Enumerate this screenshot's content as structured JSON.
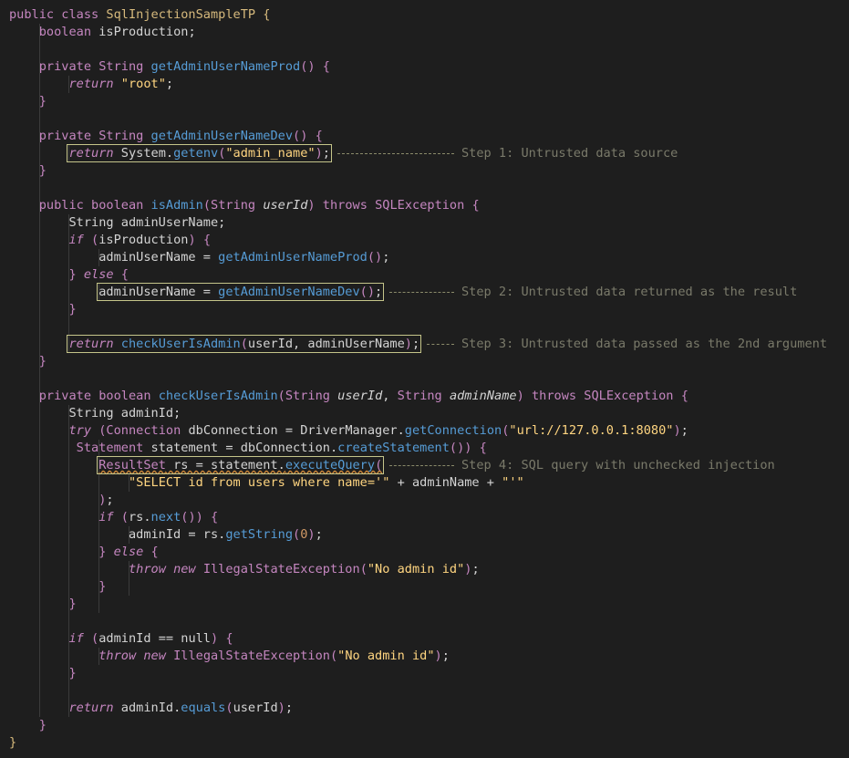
{
  "code": {
    "language": "java",
    "lines": [
      [
        [
          "kw",
          "public"
        ],
        [
          "t",
          " "
        ],
        [
          "kw",
          "class"
        ],
        [
          "t",
          " "
        ],
        [
          "cls",
          "SqlInjectionSampleTP"
        ],
        [
          "t",
          " "
        ],
        [
          "brack2",
          "{"
        ]
      ],
      [
        [
          "t",
          "    "
        ],
        [
          "kw",
          "boolean"
        ],
        [
          "t",
          " isProduction;"
        ]
      ],
      [],
      [
        [
          "t",
          "    "
        ],
        [
          "kw",
          "private"
        ],
        [
          "t",
          " "
        ],
        [
          "kw",
          "String"
        ],
        [
          "t",
          " "
        ],
        [
          "fn",
          "getAdminUserNameProd"
        ],
        [
          "paren",
          "()"
        ],
        [
          "t",
          " "
        ],
        [
          "brack",
          "{"
        ]
      ],
      [
        [
          "t",
          "        "
        ],
        [
          "kwit",
          "return"
        ],
        [
          "t",
          " "
        ],
        [
          "str",
          "\"root\""
        ],
        [
          "t",
          ";"
        ]
      ],
      [
        [
          "t",
          "    "
        ],
        [
          "brack",
          "}"
        ]
      ],
      [],
      [
        [
          "t",
          "    "
        ],
        [
          "kw",
          "private"
        ],
        [
          "t",
          " "
        ],
        [
          "kw",
          "String"
        ],
        [
          "t",
          " "
        ],
        [
          "fn",
          "getAdminUserNameDev"
        ],
        [
          "paren",
          "()"
        ],
        [
          "t",
          " "
        ],
        [
          "brack",
          "{"
        ]
      ],
      [
        [
          "t",
          "        "
        ],
        [
          "hlstart",
          ""
        ],
        [
          "kwit",
          "return"
        ],
        [
          "t",
          " System."
        ],
        [
          "fn",
          "getenv"
        ],
        [
          "paren",
          "("
        ],
        [
          "str",
          "\"admin_name\""
        ],
        [
          "paren",
          ")"
        ],
        [
          "t",
          ";"
        ],
        [
          "hlend",
          ""
        ]
      ],
      [
        [
          "t",
          "    "
        ],
        [
          "brack",
          "}"
        ]
      ],
      [],
      [
        [
          "t",
          "    "
        ],
        [
          "kw",
          "public"
        ],
        [
          "t",
          " "
        ],
        [
          "kw",
          "boolean"
        ],
        [
          "t",
          " "
        ],
        [
          "fn",
          "isAdmin"
        ],
        [
          "paren",
          "("
        ],
        [
          "kw",
          "String"
        ],
        [
          "t",
          " "
        ],
        [
          "param",
          "userId"
        ],
        [
          "paren",
          ")"
        ],
        [
          "t",
          " "
        ],
        [
          "kw",
          "throws"
        ],
        [
          "t",
          " "
        ],
        [
          "kw",
          "SQLException"
        ],
        [
          "t",
          " "
        ],
        [
          "brack",
          "{"
        ]
      ],
      [
        [
          "t",
          "        String adminUserName;"
        ]
      ],
      [
        [
          "t",
          "        "
        ],
        [
          "kwit",
          "if"
        ],
        [
          "t",
          " "
        ],
        [
          "paren",
          "("
        ],
        [
          "t",
          "isProduction"
        ],
        [
          "paren",
          ")"
        ],
        [
          "t",
          " "
        ],
        [
          "brack",
          "{"
        ]
      ],
      [
        [
          "t",
          "            adminUserName = "
        ],
        [
          "fn",
          "getAdminUserNameProd"
        ],
        [
          "paren",
          "()"
        ],
        [
          "t",
          ";"
        ]
      ],
      [
        [
          "t",
          "        "
        ],
        [
          "brack",
          "}"
        ],
        [
          "t",
          " "
        ],
        [
          "kwit",
          "else"
        ],
        [
          "t",
          " "
        ],
        [
          "brack",
          "{"
        ]
      ],
      [
        [
          "t",
          "            "
        ],
        [
          "hlstart",
          ""
        ],
        [
          "t",
          "adminUserName = "
        ],
        [
          "fn",
          "getAdminUserNameDev"
        ],
        [
          "paren",
          "()"
        ],
        [
          "t",
          ";"
        ],
        [
          "hlend",
          ""
        ]
      ],
      [
        [
          "t",
          "        "
        ],
        [
          "brack",
          "}"
        ]
      ],
      [],
      [
        [
          "t",
          "        "
        ],
        [
          "hlstart",
          ""
        ],
        [
          "kwit",
          "return"
        ],
        [
          "t",
          " "
        ],
        [
          "fn",
          "checkUserIsAdmin"
        ],
        [
          "paren",
          "("
        ],
        [
          "t",
          "userId, adminUserName"
        ],
        [
          "paren",
          ")"
        ],
        [
          "t",
          ";"
        ],
        [
          "hlend",
          ""
        ]
      ],
      [
        [
          "t",
          "    "
        ],
        [
          "brack",
          "}"
        ]
      ],
      [],
      [
        [
          "t",
          "    "
        ],
        [
          "kw",
          "private"
        ],
        [
          "t",
          " "
        ],
        [
          "kw",
          "boolean"
        ],
        [
          "t",
          " "
        ],
        [
          "fn",
          "checkUserIsAdmin"
        ],
        [
          "paren",
          "("
        ],
        [
          "kw",
          "String"
        ],
        [
          "t",
          " "
        ],
        [
          "param",
          "userId"
        ],
        [
          "t",
          ", "
        ],
        [
          "kw",
          "String"
        ],
        [
          "t",
          " "
        ],
        [
          "param",
          "adminName"
        ],
        [
          "paren",
          ")"
        ],
        [
          "t",
          " "
        ],
        [
          "kw",
          "throws"
        ],
        [
          "t",
          " "
        ],
        [
          "kw",
          "SQLException"
        ],
        [
          "t",
          " "
        ],
        [
          "brack",
          "{"
        ]
      ],
      [
        [
          "t",
          "        String adminId;"
        ]
      ],
      [
        [
          "t",
          "        "
        ],
        [
          "kwit",
          "try"
        ],
        [
          "t",
          " "
        ],
        [
          "paren",
          "("
        ],
        [
          "kw",
          "Connection"
        ],
        [
          "t",
          " dbConnection = DriverManager."
        ],
        [
          "fn",
          "getConnection"
        ],
        [
          "paren",
          "("
        ],
        [
          "str",
          "\"url://127.0.0.1:8080\""
        ],
        [
          "paren",
          ")"
        ],
        [
          "t",
          ";"
        ]
      ],
      [
        [
          "t",
          "         "
        ],
        [
          "kw",
          "Statement"
        ],
        [
          "t",
          " statement = dbConnection."
        ],
        [
          "fn",
          "createStatement"
        ],
        [
          "paren",
          "()"
        ],
        [
          "paren",
          ")"
        ],
        [
          "t",
          " "
        ],
        [
          "brack",
          "{"
        ]
      ],
      [
        [
          "t",
          "            "
        ],
        [
          "hlstart",
          ""
        ],
        [
          "sqstart",
          ""
        ],
        [
          "kw",
          "ResultSet"
        ],
        [
          "t",
          " rs = statement."
        ],
        [
          "fn",
          "executeQuery"
        ],
        [
          "paren",
          "("
        ],
        [
          "sqend",
          ""
        ],
        [
          "hlend",
          ""
        ]
      ],
      [
        [
          "t",
          "                "
        ],
        [
          "str",
          "\"SELECT id from users where name='\""
        ],
        [
          "t",
          " + adminName + "
        ],
        [
          "str",
          "\"'\""
        ]
      ],
      [
        [
          "t",
          "            "
        ],
        [
          "paren",
          ")"
        ],
        [
          "t",
          ";"
        ]
      ],
      [
        [
          "t",
          "            "
        ],
        [
          "kwit",
          "if"
        ],
        [
          "t",
          " "
        ],
        [
          "paren",
          "("
        ],
        [
          "t",
          "rs."
        ],
        [
          "fn",
          "next"
        ],
        [
          "paren",
          "()"
        ],
        [
          "paren",
          ")"
        ],
        [
          "t",
          " "
        ],
        [
          "brack",
          "{"
        ]
      ],
      [
        [
          "t",
          "                adminId = rs."
        ],
        [
          "fn",
          "getString"
        ],
        [
          "paren",
          "("
        ],
        [
          "num",
          "0"
        ],
        [
          "paren",
          ")"
        ],
        [
          "t",
          ";"
        ]
      ],
      [
        [
          "t",
          "            "
        ],
        [
          "brack",
          "}"
        ],
        [
          "t",
          " "
        ],
        [
          "kwit",
          "else"
        ],
        [
          "t",
          " "
        ],
        [
          "brack",
          "{"
        ]
      ],
      [
        [
          "t",
          "                "
        ],
        [
          "kwit",
          "throw"
        ],
        [
          "t",
          " "
        ],
        [
          "kwit",
          "new"
        ],
        [
          "t",
          " "
        ],
        [
          "kw",
          "IllegalStateException"
        ],
        [
          "paren",
          "("
        ],
        [
          "str",
          "\"No admin id\""
        ],
        [
          "paren",
          ")"
        ],
        [
          "t",
          ";"
        ]
      ],
      [
        [
          "t",
          "            "
        ],
        [
          "brack",
          "}"
        ]
      ],
      [
        [
          "t",
          "        "
        ],
        [
          "brack",
          "}"
        ]
      ],
      [],
      [
        [
          "t",
          "        "
        ],
        [
          "kwit",
          "if"
        ],
        [
          "t",
          " "
        ],
        [
          "paren",
          "("
        ],
        [
          "t",
          "adminId == null"
        ],
        [
          "paren",
          ")"
        ],
        [
          "t",
          " "
        ],
        [
          "brack",
          "{"
        ]
      ],
      [
        [
          "t",
          "            "
        ],
        [
          "kwit",
          "throw"
        ],
        [
          "t",
          " "
        ],
        [
          "kwit",
          "new"
        ],
        [
          "t",
          " "
        ],
        [
          "kw",
          "IllegalStateException"
        ],
        [
          "paren",
          "("
        ],
        [
          "str",
          "\"No admin id\""
        ],
        [
          "paren",
          ")"
        ],
        [
          "t",
          ";"
        ]
      ],
      [
        [
          "t",
          "        "
        ],
        [
          "brack",
          "}"
        ]
      ],
      [],
      [
        [
          "t",
          "        "
        ],
        [
          "kwit",
          "return"
        ],
        [
          "t",
          " adminId."
        ],
        [
          "fn",
          "equals"
        ],
        [
          "paren",
          "("
        ],
        [
          "t",
          "userId"
        ],
        [
          "paren",
          ")"
        ],
        [
          "t",
          ";"
        ]
      ],
      [
        [
          "t",
          "    "
        ],
        [
          "brack",
          "}"
        ]
      ],
      [
        [
          "brack2",
          "}"
        ]
      ]
    ],
    "annotations": [
      {
        "line": 8,
        "text": "Step 1: Untrusted data source"
      },
      {
        "line": 16,
        "text": "Step 2: Untrusted data returned as the result"
      },
      {
        "line": 19,
        "text": "Step 3: Untrusted data passed as the 2nd argument"
      },
      {
        "line": 26,
        "text": "Step 4: SQL query with unchecked injection"
      }
    ]
  },
  "colors": {
    "background": "#1e1e1e",
    "keyword": "#c586c0",
    "function": "#569cd6",
    "string": "#ffd580",
    "class": "#d7ba7d",
    "annotation": "#7a7a6a",
    "highlight_box": "#c5c58a",
    "squiggle": "#d08a3a"
  }
}
